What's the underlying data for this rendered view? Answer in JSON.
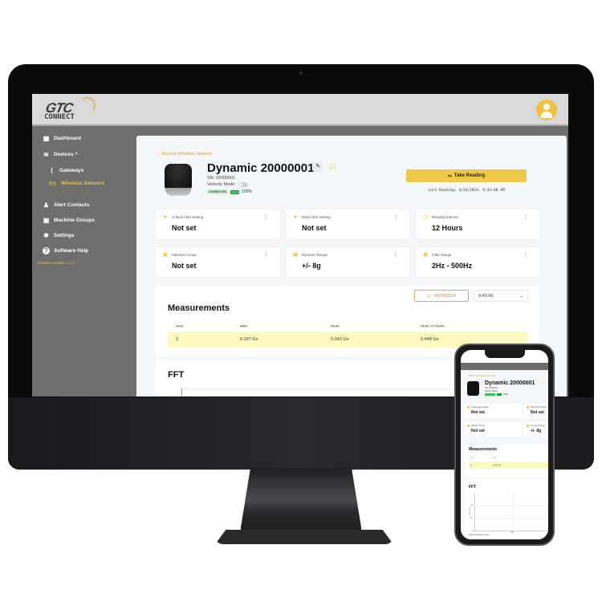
{
  "app": {
    "logo_text": "GTC",
    "logo_subtext": "CONNECT",
    "user_avatar_icon": "user-avatar-icon"
  },
  "sidebar": {
    "items": [
      {
        "label": "Dashboard",
        "icon": "dashboard-icon",
        "glyph": "▦",
        "active": false
      },
      {
        "label": "Devices ^",
        "icon": "wifi-icon",
        "glyph": "≋",
        "active": false
      },
      {
        "label": "Gateways",
        "icon": "gateway-icon",
        "glyph": "⟨",
        "active": false,
        "sub": true
      },
      {
        "label": "Wireless Sensors",
        "icon": "wireless-sensor-icon",
        "glyph": "((•))",
        "active": true,
        "sub": true
      },
      {
        "label": "Alert Contacts",
        "icon": "bell-icon",
        "glyph": "♟",
        "active": false
      },
      {
        "label": "Machine Groups",
        "icon": "machine-group-icon",
        "glyph": "▣",
        "active": false
      },
      {
        "label": "Settings",
        "icon": "gear-icon",
        "glyph": "✱",
        "active": false
      },
      {
        "label": "Software Help",
        "icon": "help-icon",
        "glyph": "?",
        "active": false
      }
    ],
    "version": "Software Version: 1.0.1"
  },
  "sensor": {
    "back_link": "← Back to Wireless Sensors",
    "name": "Dynamic 20000001",
    "sn": "SN: 20000001",
    "velocity_mode_label": "Velocity Mode:",
    "velocity_mode_on": false,
    "status": "CONNECTED",
    "battery": "100%",
    "battery_fraction": 1.0,
    "take_reading_label": "Take Reading",
    "last_reading": "Last Reading: 4/24/2024, 9:43:00 AM"
  },
  "cards": [
    {
      "label": "Critical Alert Setting",
      "value": "Not set",
      "icon": "alert-icon"
    },
    {
      "label": "Early Alert Setting",
      "value": "Not set",
      "icon": "alert-icon"
    },
    {
      "label": "Reading Interval",
      "value": "12 Hours",
      "icon": "clock-icon"
    },
    {
      "label": "Machine Group",
      "value": "Not set",
      "icon": "machine-group-icon"
    },
    {
      "label": "Dynamic Range",
      "value": "+/- 8g",
      "icon": "range-icon"
    },
    {
      "label": "Filter Range",
      "value": "2Hz - 500Hz",
      "icon": "filter-icon"
    }
  ],
  "measurements": {
    "title": "Measurements",
    "date": "04/24/2024",
    "time": "9:43:00",
    "columns": [
      "AXIS",
      "RMS",
      "PEAK",
      "PEAK TO PEAK"
    ],
    "rows": [
      [
        "Z",
        "0.037 Gs",
        "0.243 Gs",
        "0.448 Gs"
      ]
    ]
  },
  "fft": {
    "title": "FFT",
    "mobile_y_ticks": [
      "0.2",
      "0.1",
      "0"
    ],
    "mobile_y_label": "Amplitude",
    "mobile_x_tick": "125",
    "mobile_hint": "Click and drag to zoom"
  },
  "colors": {
    "accent": "#f0c43a",
    "sidebar_bg": "#6e6e6e",
    "header_bg": "#d9d9d9",
    "highlight_row": "#fdf8be",
    "connected": "#38c45a"
  }
}
